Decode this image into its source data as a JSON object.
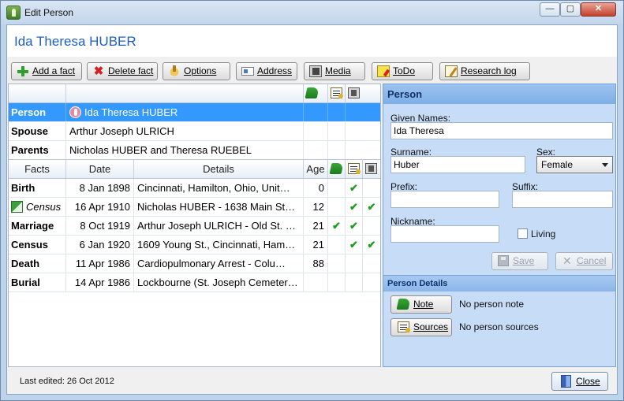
{
  "window": {
    "title": "Edit Person",
    "controls": {
      "minimize": "—",
      "maximize": "▢",
      "close": "✕"
    }
  },
  "header": {
    "person_name": "Ida Theresa HUBER"
  },
  "toolbar": {
    "add_fact": "Add a fact",
    "delete_fact": "Delete fact",
    "options": "Options",
    "address": "Address",
    "media": "Media",
    "todo": "ToDo",
    "research_log": "Research log"
  },
  "relations": [
    {
      "role": "Person",
      "name": "Ida Theresa HUBER"
    },
    {
      "role": "Spouse",
      "name": "Arthur Joseph ULRICH"
    },
    {
      "role": "Parents",
      "name": "Nicholas HUBER and Theresa RUEBEL"
    }
  ],
  "facts_header": {
    "facts": "Facts",
    "date": "Date",
    "details": "Details",
    "age": "Age"
  },
  "facts": [
    {
      "fact": "Birth",
      "date": "8 Jan 1898",
      "details": "Cincinnati, Hamilton, Ohio, Unit…",
      "age": "0",
      "note": "",
      "sources": "✔",
      "media": ""
    },
    {
      "fact": "Census",
      "date": "16 Apr 1910",
      "details": "Nicholas HUBER - 1638 Main St…",
      "age": "12",
      "note": "",
      "sources": "✔",
      "media": "✔"
    },
    {
      "fact": "Marriage",
      "date": "8 Oct 1919",
      "details": "Arthur Joseph ULRICH - Old St. …",
      "age": "21",
      "note": "✔",
      "sources": "✔",
      "media": ""
    },
    {
      "fact": "Census",
      "date": "6 Jan 1920",
      "details": "1609 Young St., Cincinnati, Ham…",
      "age": "21",
      "note": "",
      "sources": "✔",
      "media": "✔"
    },
    {
      "fact": "Death",
      "date": "11 Apr 1986",
      "details": "Cardiopulmonary Arrest - Colu…",
      "age": "88",
      "note": "",
      "sources": "",
      "media": ""
    },
    {
      "fact": "Burial",
      "date": "14 Apr 1986",
      "details": "Lockbourne (St. Joseph Cemeter…",
      "age": "",
      "note": "",
      "sources": "",
      "media": ""
    }
  ],
  "person_panel": {
    "title": "Person",
    "given_names_label": "Given Names:",
    "given_names": "Ida Theresa",
    "surname_label": "Surname:",
    "surname": "Huber",
    "sex_label": "Sex:",
    "sex": "Female",
    "prefix_label": "Prefix:",
    "prefix": "",
    "suffix_label": "Suffix:",
    "suffix": "",
    "nickname_label": "Nickname:",
    "nickname": "",
    "living_label": "Living",
    "save": "Save",
    "cancel": "Cancel"
  },
  "person_details": {
    "title": "Person Details",
    "note_button": "Note",
    "note_text": "No person note",
    "sources_button": "Sources",
    "sources_text": "No person sources"
  },
  "status": {
    "last_edited": "Last edited: 26 Oct 2012",
    "close": "Close"
  },
  "colors": {
    "accent": "#1e5fbf",
    "selection": "#3399ff",
    "panel": "#c7dcf6",
    "check": "#1f9a1f"
  }
}
